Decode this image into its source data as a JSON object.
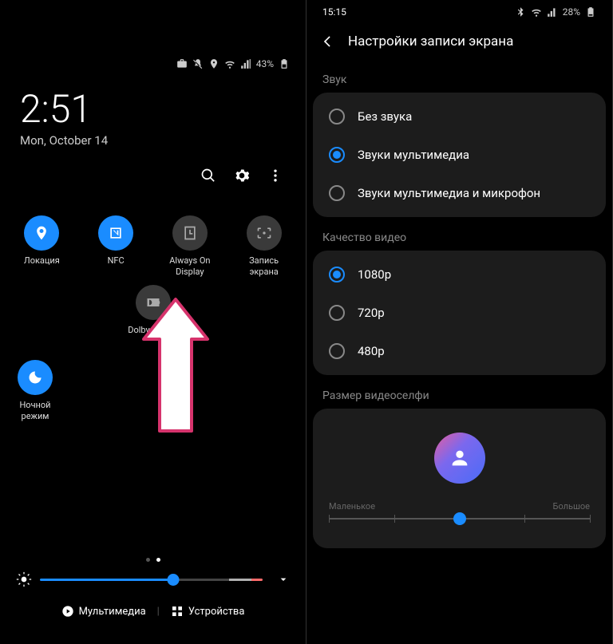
{
  "left": {
    "status": {
      "battery": "43%"
    },
    "clock": {
      "time": "2:51",
      "date": "Mon, October 14"
    },
    "tiles": {
      "location": "Локация",
      "nfc": "NFC",
      "always_on": "Always On Display",
      "screen_record": "Запись экрана",
      "dolby": "Dolby Atmos",
      "night_mode": "Ночной режим"
    },
    "bottom": {
      "multimedia": "Мультимедиа",
      "devices": "Устройства"
    }
  },
  "right": {
    "status": {
      "time": "15:15",
      "battery": "28%"
    },
    "title": "Настройки записи экрана",
    "sound": {
      "section": "Звук",
      "opt1": "Без звука",
      "opt2": "Звуки мультимедиа",
      "opt3": "Звуки мультимедиа и микрофон",
      "selected": 1
    },
    "quality": {
      "section": "Качество видео",
      "opt1": "1080p",
      "opt2": "720p",
      "opt3": "480p",
      "selected": 0
    },
    "selfie": {
      "section": "Размер видеоселфи",
      "min": "Маленькое",
      "max": "Большое"
    }
  }
}
